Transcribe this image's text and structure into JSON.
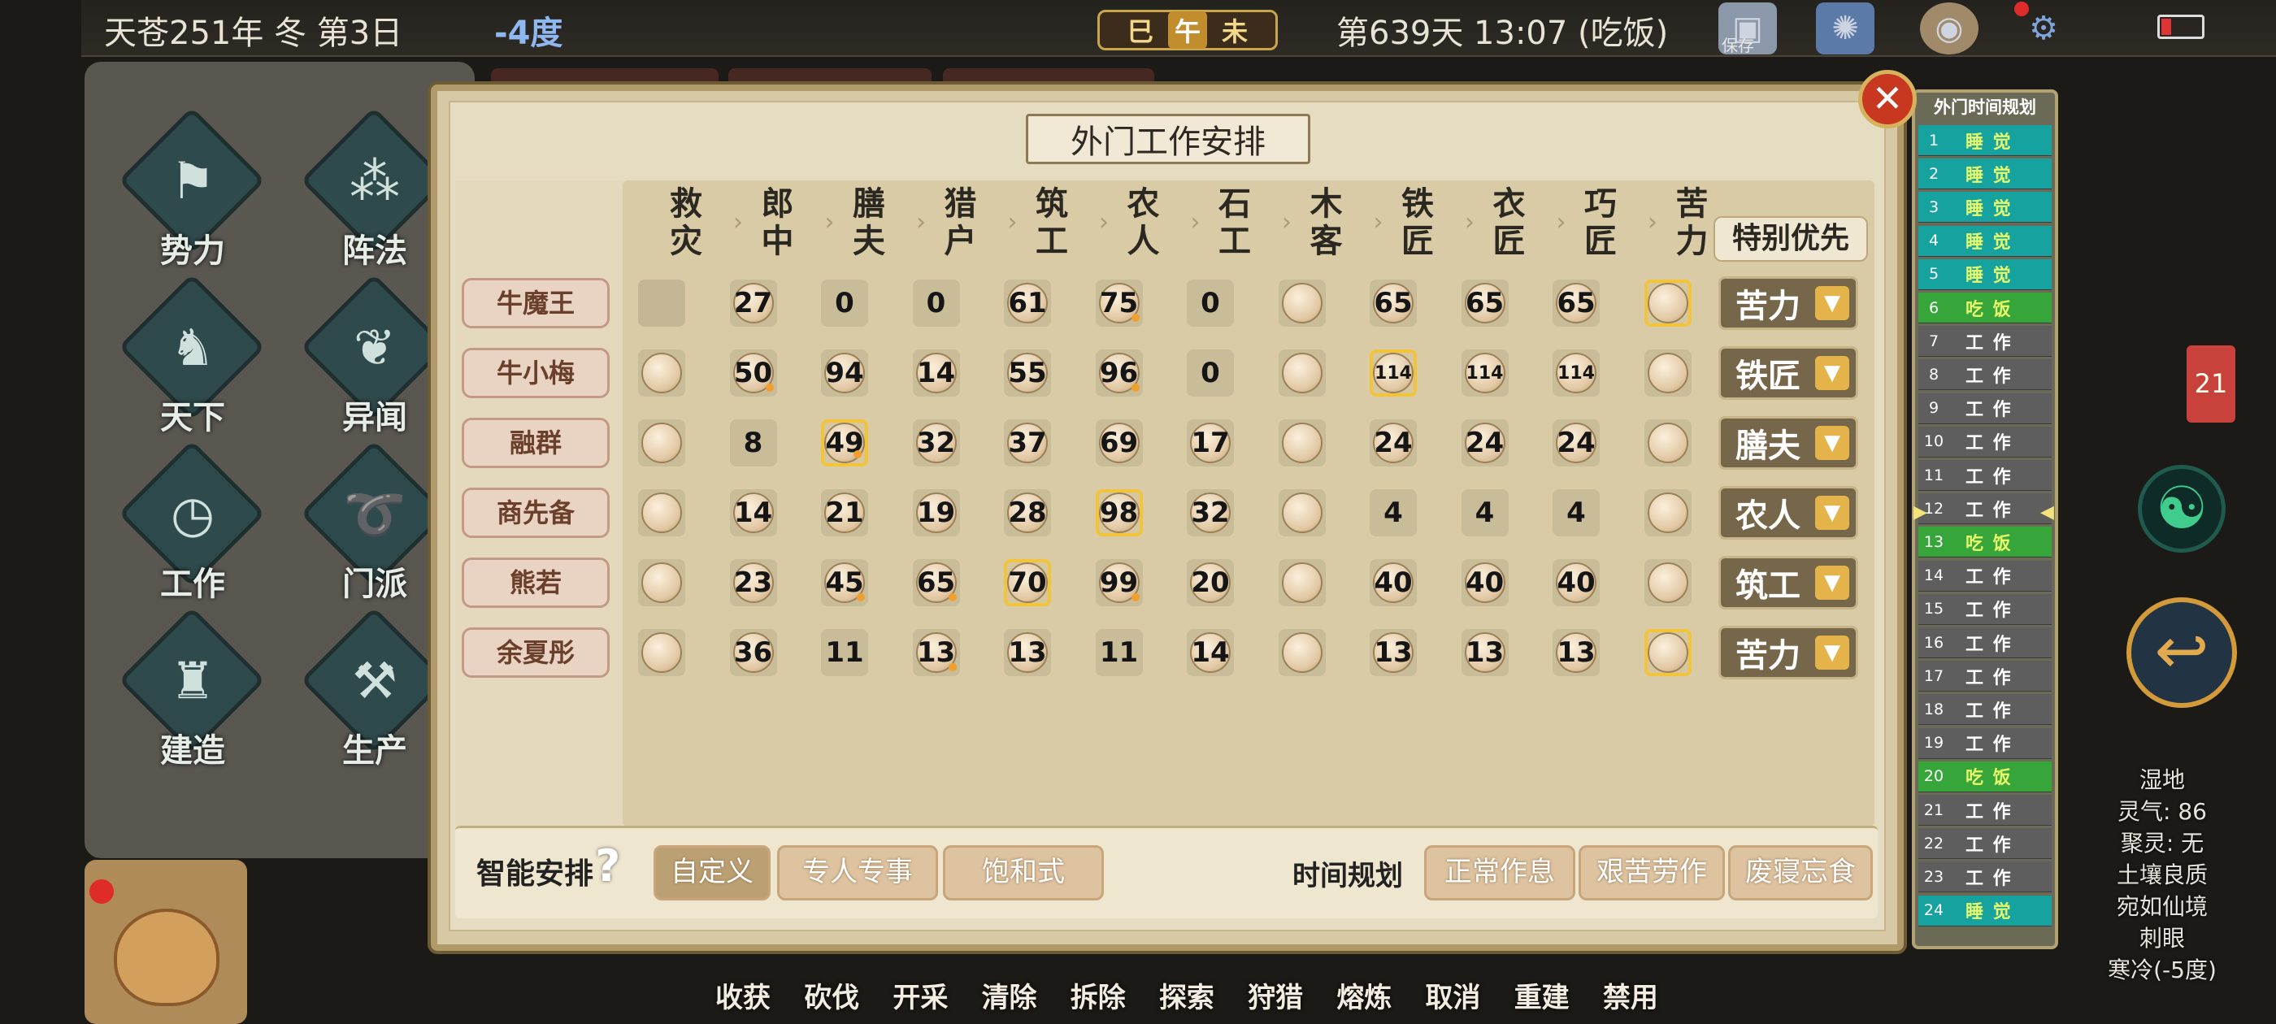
{
  "topbar": {
    "date": "天苍251年 冬 第3日",
    "temperature": "-4度",
    "ganzhi": [
      "巳",
      "午",
      "未"
    ],
    "day_time": "第639天 13:07 (吃饭)",
    "save_label": "保存"
  },
  "left_menu": [
    {
      "label": "势力",
      "icon": "banner-icon"
    },
    {
      "label": "阵法",
      "icon": "formation-icon"
    },
    {
      "label": "天下",
      "icon": "horse-icon"
    },
    {
      "label": "异闻",
      "icon": "butterfly-icon"
    },
    {
      "label": "工作",
      "icon": "clock-icon"
    },
    {
      "label": "门派",
      "icon": "snail-icon"
    },
    {
      "label": "建造",
      "icon": "tower-icon"
    },
    {
      "label": "生产",
      "icon": "hammer-icon"
    }
  ],
  "bottom_toolbar": [
    "收获",
    "砍伐",
    "开采",
    "清除",
    "拆除",
    "探索",
    "狩猎",
    "熔炼",
    "取消",
    "重建",
    "禁用"
  ],
  "dialog": {
    "title": "外门工作安排",
    "columns": [
      [
        "救",
        "灾"
      ],
      [
        "郎",
        "中"
      ],
      [
        "膳",
        "夫"
      ],
      [
        "猎",
        "户"
      ],
      [
        "筑",
        "工"
      ],
      [
        "农",
        "人"
      ],
      [
        "石",
        "工"
      ],
      [
        "木",
        "客"
      ],
      [
        "铁",
        "匠"
      ],
      [
        "衣",
        "匠"
      ],
      [
        "巧",
        "匠"
      ],
      [
        "苦",
        "力"
      ]
    ],
    "priority_header": "特别优先",
    "rows": [
      {
        "name": "牛魔王",
        "cells": [
          [
            "e"
          ],
          [
            "27"
          ],
          [
            "0",
            "p"
          ],
          [
            "0",
            "p"
          ],
          [
            "61"
          ],
          [
            "75",
            "d"
          ],
          [
            "0",
            "p"
          ],
          [
            ""
          ],
          [
            "65"
          ],
          [
            "65"
          ],
          [
            "65"
          ],
          [
            "",
            "h"
          ]
        ],
        "priority": "苦力"
      },
      {
        "name": "牛小梅",
        "cells": [
          [
            ""
          ],
          [
            "50",
            "d"
          ],
          [
            "94"
          ],
          [
            "14"
          ],
          [
            "55"
          ],
          [
            "96",
            "d"
          ],
          [
            "0",
            "p"
          ],
          [
            ""
          ],
          [
            "114",
            "hs"
          ],
          [
            "114",
            "s"
          ],
          [
            "114",
            "s"
          ],
          [
            ""
          ]
        ],
        "priority": "铁匠"
      },
      {
        "name": "融群",
        "cells": [
          [
            ""
          ],
          [
            "8",
            "p"
          ],
          [
            "49",
            "hd"
          ],
          [
            "32"
          ],
          [
            "37"
          ],
          [
            "69"
          ],
          [
            "17"
          ],
          [
            ""
          ],
          [
            "24"
          ],
          [
            "24"
          ],
          [
            "24"
          ],
          [
            ""
          ]
        ],
        "priority": "膳夫"
      },
      {
        "name": "商先备",
        "cells": [
          [
            ""
          ],
          [
            "14"
          ],
          [
            "21"
          ],
          [
            "19"
          ],
          [
            "28"
          ],
          [
            "98",
            "h"
          ],
          [
            "32"
          ],
          [
            ""
          ],
          [
            "4",
            "p"
          ],
          [
            "4",
            "p"
          ],
          [
            "4",
            "p"
          ],
          [
            ""
          ]
        ],
        "priority": "农人"
      },
      {
        "name": "熊若",
        "cells": [
          [
            ""
          ],
          [
            "23"
          ],
          [
            "45",
            "d"
          ],
          [
            "65",
            "d"
          ],
          [
            "70",
            "h"
          ],
          [
            "99",
            "d"
          ],
          [
            "20"
          ],
          [
            ""
          ],
          [
            "40"
          ],
          [
            "40"
          ],
          [
            "40"
          ],
          [
            ""
          ]
        ],
        "priority": "筑工"
      },
      {
        "name": "余夏彤",
        "cells": [
          [
            ""
          ],
          [
            "36"
          ],
          [
            "11",
            "p"
          ],
          [
            "13",
            "d"
          ],
          [
            "13"
          ],
          [
            "11",
            "p"
          ],
          [
            "14"
          ],
          [
            ""
          ],
          [
            "13"
          ],
          [
            "13"
          ],
          [
            "13"
          ],
          [
            "",
            "h"
          ]
        ],
        "priority": "苦力"
      }
    ],
    "smart_label": "智能安排",
    "help": "?",
    "modes": [
      "自定义",
      "专人专事",
      "饱和式"
    ],
    "time_label": "时间规划",
    "time_modes": [
      "正常作息",
      "艰苦劳作",
      "废寝忘食"
    ]
  },
  "schedule": {
    "title": "外门时间规划",
    "hours": [
      {
        "n": "1",
        "label": "睡 觉",
        "type": "sleep"
      },
      {
        "n": "2",
        "label": "睡 觉",
        "type": "sleep"
      },
      {
        "n": "3",
        "label": "睡 觉",
        "type": "sleep"
      },
      {
        "n": "4",
        "label": "睡 觉",
        "type": "sleep"
      },
      {
        "n": "5",
        "label": "睡 觉",
        "type": "sleep"
      },
      {
        "n": "6",
        "label": "吃 饭",
        "type": "eat"
      },
      {
        "n": "7",
        "label": "工 作",
        "type": "work"
      },
      {
        "n": "8",
        "label": "工 作",
        "type": "work"
      },
      {
        "n": "9",
        "label": "工 作",
        "type": "work"
      },
      {
        "n": "10",
        "label": "工 作",
        "type": "work"
      },
      {
        "n": "11",
        "label": "工 作",
        "type": "work"
      },
      {
        "n": "12",
        "label": "工 作",
        "type": "work"
      },
      {
        "n": "13",
        "label": "吃 饭",
        "type": "eat"
      },
      {
        "n": "14",
        "label": "工 作",
        "type": "work"
      },
      {
        "n": "15",
        "label": "工 作",
        "type": "work"
      },
      {
        "n": "16",
        "label": "工 作",
        "type": "work"
      },
      {
        "n": "17",
        "label": "工 作",
        "type": "work"
      },
      {
        "n": "18",
        "label": "工 作",
        "type": "work"
      },
      {
        "n": "19",
        "label": "工 作",
        "type": "work"
      },
      {
        "n": "20",
        "label": "吃 饭",
        "type": "eat"
      },
      {
        "n": "21",
        "label": "工 作",
        "type": "work"
      },
      {
        "n": "22",
        "label": "工 作",
        "type": "work"
      },
      {
        "n": "23",
        "label": "工 作",
        "type": "work"
      },
      {
        "n": "24",
        "label": "睡 觉",
        "type": "sleep"
      }
    ]
  },
  "side": {
    "badge": "21",
    "env": [
      "湿地",
      "灵气: 86",
      "聚灵: 无",
      "土壤良质",
      "宛如仙境",
      "刺眼",
      "寒冷(-5度)"
    ]
  }
}
